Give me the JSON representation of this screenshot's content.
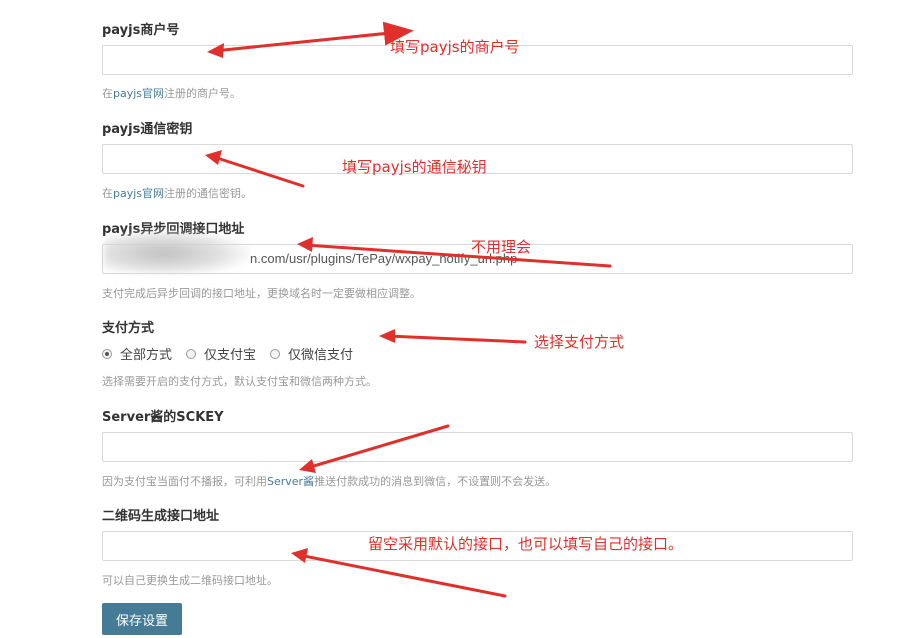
{
  "fields": {
    "merchant_id": {
      "label": "payjs商户号",
      "value": "",
      "desc_prefix": "在",
      "desc_link": "payjs官网",
      "desc_suffix": "注册的商户号。"
    },
    "secret_key": {
      "label": "payjs通信密钥",
      "value": "",
      "desc_prefix": "在",
      "desc_link": "payjs官网",
      "desc_suffix": "注册的通信密钥。"
    },
    "notify_url": {
      "label": "payjs异步回调接口地址",
      "value": "n.com/usr/plugins/TePay/wxpay_notify_url.php",
      "desc": "支付完成后异步回调的接口地址，更换域名时一定要做相应调整。"
    },
    "pay_method": {
      "label": "支付方式",
      "options": [
        "全部方式",
        "仅支付宝",
        "仅微信支付"
      ],
      "selected": "全部方式",
      "desc": "选择需要开启的支付方式，默认支付宝和微信两种方式。"
    },
    "sckey": {
      "label": "Server酱的SCKEY",
      "value": "",
      "desc_prefix": "因为支付宝当面付不播报，可利用",
      "desc_link": "Server酱",
      "desc_suffix": "推送付款成功的消息到微信，不设置则不会发送。"
    },
    "qr_api": {
      "label": "二维码生成接口地址",
      "value": "",
      "desc": "可以自己更换生成二维码接口地址。"
    }
  },
  "save_button": "保存设置",
  "annotations": {
    "merchant": "填写payjs的商户号",
    "secret": "填写payjs的通信秘钥",
    "notify": "不用理会",
    "method": "选择支付方式",
    "qr": "留空采用默认的接口，也可以填写自己的接口。"
  },
  "colors": {
    "accent": "#467b96",
    "annotation": "#e0302c"
  }
}
